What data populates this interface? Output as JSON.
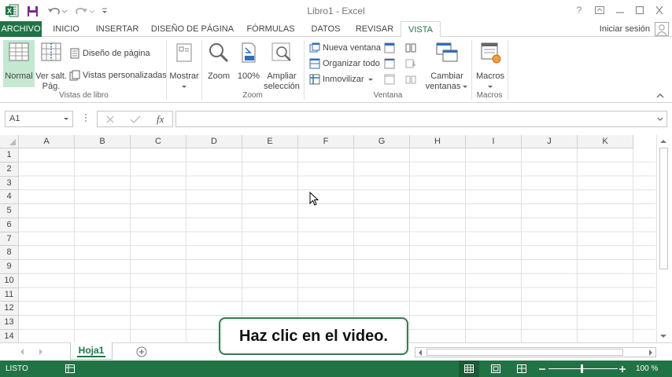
{
  "window": {
    "title": "Libro1 - Excel",
    "help": "?"
  },
  "tabs": [
    {
      "label": "ARCHIVO"
    },
    {
      "label": "INICIO"
    },
    {
      "label": "INSERTAR"
    },
    {
      "label": "DISEÑO DE PÁGINA"
    },
    {
      "label": "FÓRMULAS"
    },
    {
      "label": "DATOS"
    },
    {
      "label": "REVISAR"
    },
    {
      "label": "VISTA"
    }
  ],
  "active_tab": "VISTA",
  "signin": "Iniciar sesión",
  "ribbon": {
    "vistas": {
      "normal": "Normal",
      "ver_salt_1": "Ver salt.",
      "ver_salt_2": "Pág.",
      "diseno_pagina": "Diseño de página",
      "vistas_personalizadas": "Vistas personalizadas",
      "group": "Vistas de libro"
    },
    "mostrar": "Mostrar",
    "zoom": {
      "zoom": "Zoom",
      "zoom100": "100%",
      "ampliar_1": "Ampliar",
      "ampliar_2": "selección",
      "group": "Zoom"
    },
    "ventana": {
      "nueva": "Nueva ventana",
      "organizar": "Organizar todo",
      "inmovilizar": "Inmovilizar",
      "cambiar_1": "Cambiar",
      "cambiar_2": "ventanas",
      "group": "Ventana"
    },
    "macros": {
      "macros": "Macros",
      "group": "Macros"
    }
  },
  "formula_bar": {
    "name_box": "A1",
    "fx": "fx",
    "value": ""
  },
  "columns": [
    "A",
    "B",
    "C",
    "D",
    "E",
    "F",
    "G",
    "H",
    "I",
    "J",
    "K"
  ],
  "rows": [
    "1",
    "2",
    "3",
    "4",
    "5",
    "6",
    "7",
    "8",
    "9",
    "10",
    "11",
    "12",
    "13",
    "14"
  ],
  "sheets": [
    {
      "name": "Hoja1"
    }
  ],
  "status": {
    "ready": "LISTO",
    "zoom": "100 %"
  },
  "callout": "Haz clic en el video.",
  "colors": {
    "accent": "#217346",
    "normal_highlight": "#c5e8d0"
  }
}
